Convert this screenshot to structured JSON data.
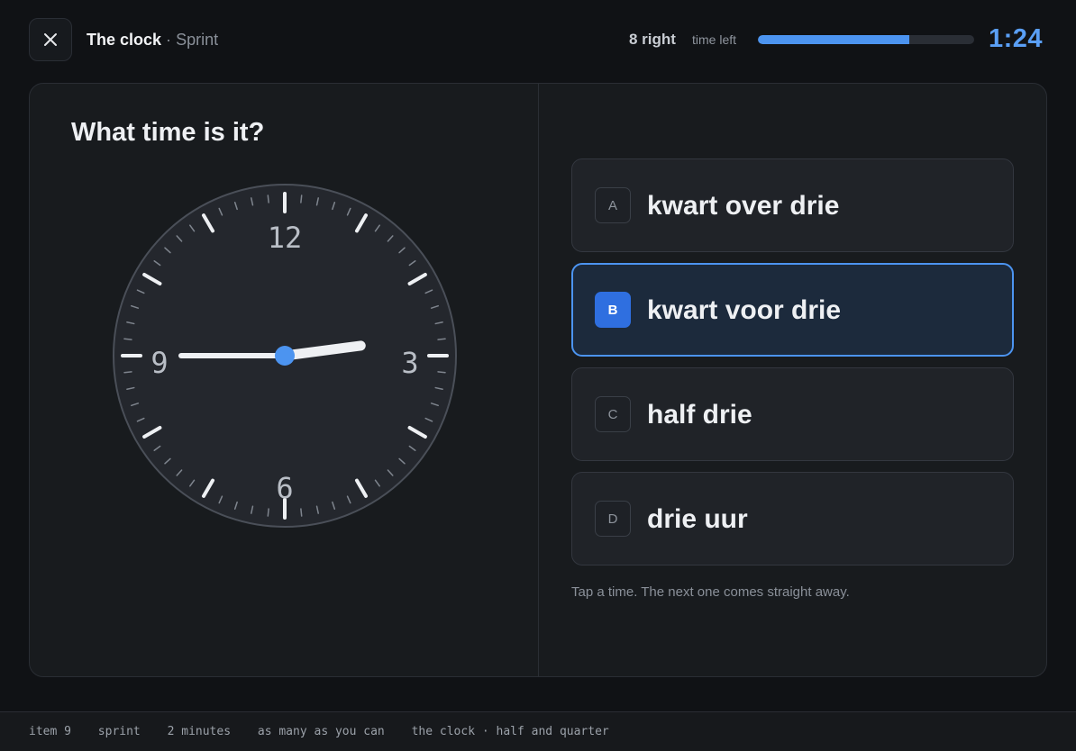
{
  "header": {
    "title": "The clock",
    "separator": "·",
    "mode": "Sprint",
    "score": "8 right",
    "time_left_label": "time left",
    "time_left_fraction": 0.7,
    "timer": "1:24"
  },
  "question": {
    "prompt": "What time is it?",
    "clock": {
      "numerals": [
        "12",
        "3",
        "6",
        "9"
      ],
      "hour": 2,
      "minute": 45,
      "face_color": "#24272d",
      "hand_color": "#eef0f3",
      "hub_color": "#4c94f0"
    }
  },
  "options": [
    {
      "key": "A",
      "label": "kwart over drie",
      "selected": false
    },
    {
      "key": "B",
      "label": "kwart voor drie",
      "selected": true
    },
    {
      "key": "C",
      "label": "half drie",
      "selected": false
    },
    {
      "key": "D",
      "label": "drie uur",
      "selected": false
    }
  ],
  "hint": "Tap a time. The next one comes straight away.",
  "footer": {
    "items": [
      "item 9",
      "sprint",
      "2 minutes",
      "as many as you can",
      "the clock · half and quarter"
    ]
  },
  "colors": {
    "accent": "#4c94f0",
    "selected_bg": "#1c2a3c",
    "background": "#101215"
  },
  "icons": {
    "close": "close-icon"
  }
}
